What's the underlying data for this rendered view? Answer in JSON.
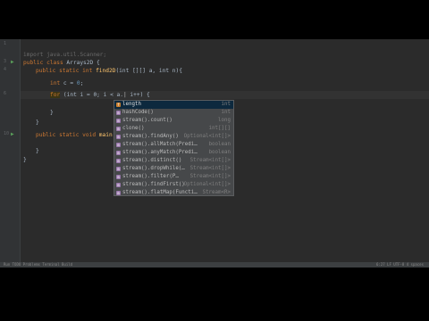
{
  "editor": {
    "lines": [
      {
        "num": "1",
        "text": "import java.util.Scanner;"
      },
      {
        "num": "2",
        "text": ""
      },
      {
        "num": "3",
        "kw": "public class",
        "rest": " Arrays2D {"
      },
      {
        "num": "4",
        "kw": "public static",
        "type": " int ",
        "fn": "find2D",
        "rest": "(int [][] a, int n){"
      },
      {
        "num": "5",
        "kw": "int",
        "rest": " c = ",
        "num_val": "0",
        "end": ";"
      },
      {
        "num": "6",
        "hl": "for",
        "rest": " (int i = 0; i < a.",
        "caret": "|",
        "end": " i++) {"
      },
      {
        "num": "7",
        "text": ""
      },
      {
        "num": "8",
        "text": "}"
      },
      {
        "num": "9",
        "text": "}"
      },
      {
        "num": "10",
        "kw": "public static void",
        "rest": " main("
      },
      {
        "num": "11",
        "text": ""
      },
      {
        "num": "12",
        "text": "}"
      },
      {
        "num": "13",
        "text": "}"
      }
    ]
  },
  "completion": {
    "items": [
      {
        "icon": "f",
        "name": "length",
        "type": "int"
      },
      {
        "icon": "m",
        "name": "hashCode()",
        "type": "int"
      },
      {
        "icon": "m",
        "name": "stream().count()",
        "type": "long"
      },
      {
        "icon": "m",
        "name": "clone()",
        "type": "int[][]"
      },
      {
        "icon": "m",
        "name": "stream().findAny()",
        "type": "Optional<int[]>"
      },
      {
        "icon": "m",
        "name": "stream().allMatch(Predi…",
        "type": "boolean"
      },
      {
        "icon": "m",
        "name": "stream().anyMatch(Predi…",
        "type": "boolean"
      },
      {
        "icon": "m",
        "name": "stream().distinct()",
        "type": "Stream<int[]>"
      },
      {
        "icon": "m",
        "name": "stream().dropWhile(…",
        "type": "Stream<int[]>"
      },
      {
        "icon": "m",
        "name": "stream().filter(P…",
        "type": "Stream<int[]>"
      },
      {
        "icon": "m",
        "name": "stream().findFirst()",
        "type": "Optional<int[]>"
      },
      {
        "icon": "m",
        "name": "stream().flatMap(Functi…",
        "type": "Stream<R>"
      }
    ]
  },
  "status": {
    "left": "Run  TODO  Problems  Terminal  Build",
    "right": "6:27  LF  UTF-8  4 spaces"
  }
}
